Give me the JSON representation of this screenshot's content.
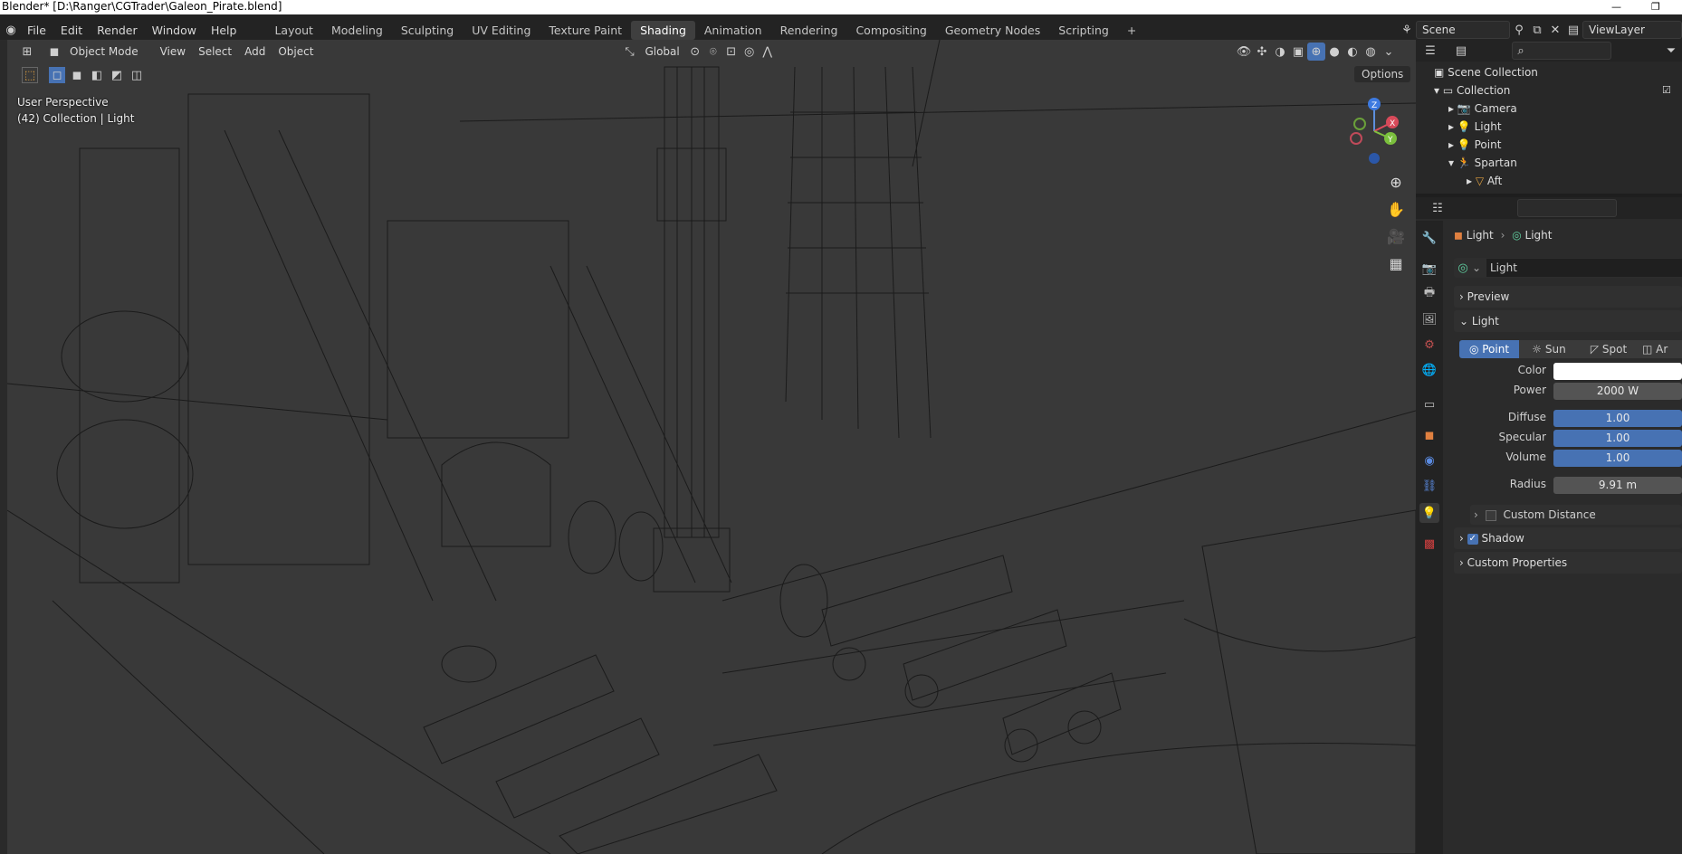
{
  "window": {
    "title": "Blender* [D:\\Ranger\\CGTrader\\Galeon_Pirate.blend]"
  },
  "menu": [
    "File",
    "Edit",
    "Render",
    "Window",
    "Help"
  ],
  "workspaces": [
    "Layout",
    "Modeling",
    "Sculpting",
    "UV Editing",
    "Texture Paint",
    "Shading",
    "Animation",
    "Rendering",
    "Compositing",
    "Geometry Nodes",
    "Scripting"
  ],
  "active_workspace": "Shading",
  "scene": {
    "name": "Scene",
    "view_layer": "ViewLayer"
  },
  "viewport": {
    "mode": "Object Mode",
    "menus": [
      "View",
      "Select",
      "Add",
      "Object"
    ],
    "transform_orientation": "Global",
    "options_label": "Options",
    "perspective_label": "User Perspective",
    "collection_label": "(42) Collection | Light",
    "gizmo_axes": [
      "X",
      "Y",
      "Z"
    ]
  },
  "outliner": {
    "root": "Scene Collection",
    "collection": "Collection",
    "items": [
      {
        "name": "Camera",
        "icon": "camera-icon"
      },
      {
        "name": "Light",
        "icon": "light-icon"
      },
      {
        "name": "Point",
        "icon": "light-icon"
      },
      {
        "name": "Spartan",
        "icon": "armature-icon"
      },
      {
        "name": "Aft",
        "icon": "mesh-icon"
      }
    ]
  },
  "properties": {
    "breadcrumb": [
      "Light",
      "Light"
    ],
    "datablock": "Light",
    "panels": {
      "preview": "Preview",
      "light": "Light",
      "shadow": "Shadow",
      "custom_props": "Custom Properties",
      "custom_distance": "Custom Distance"
    },
    "light_types": [
      "Point",
      "Sun",
      "Spot",
      "Ar"
    ],
    "active_light_type": "Point",
    "fields": {
      "color_label": "Color",
      "power_label": "Power",
      "power": "2000 W",
      "diffuse_label": "Diffuse",
      "diffuse": "1.00",
      "specular_label": "Specular",
      "specular": "1.00",
      "volume_label": "Volume",
      "volume": "1.00",
      "radius_label": "Radius",
      "radius": "9.91 m"
    },
    "shadow_enabled": true,
    "custom_distance_enabled": false
  },
  "colors": {
    "accent": "#4772b3",
    "header": "#232323",
    "viewport_bg": "#393939"
  }
}
